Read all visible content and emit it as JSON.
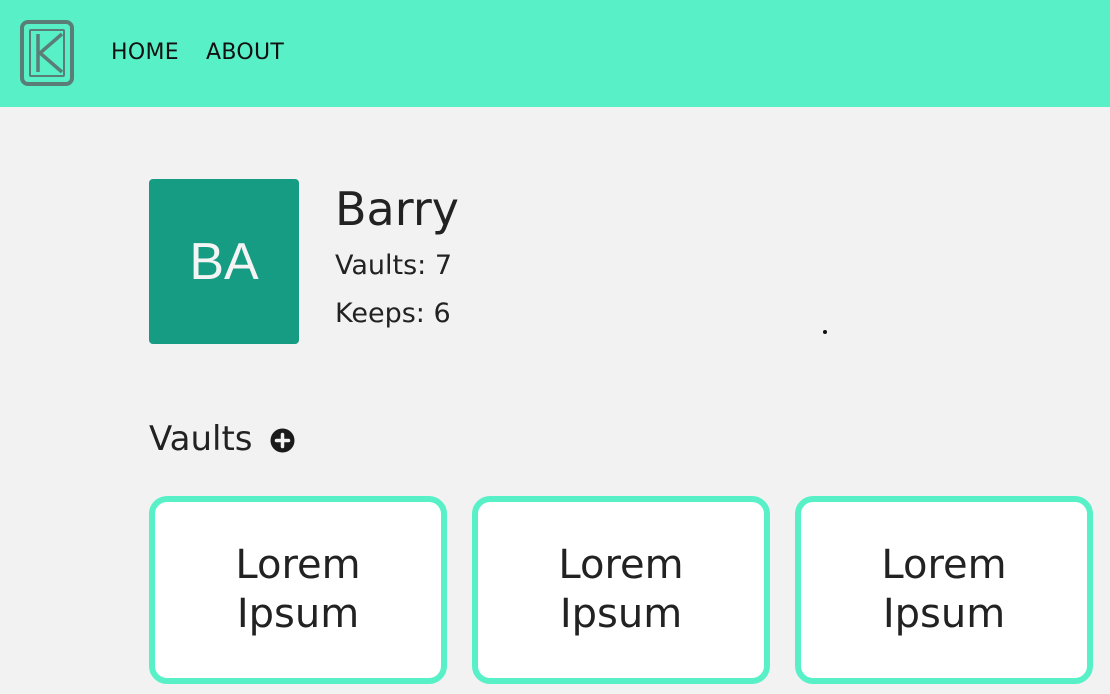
{
  "nav": {
    "home_label": "HOME",
    "about_label": "ABOUT",
    "logo_letter": "K",
    "colors": {
      "bar": "#58f0c6",
      "logo_stroke": "#5a7d78"
    }
  },
  "profile": {
    "initials": "BA",
    "name": "Barry",
    "vaults_label": "Vaults: 7",
    "keeps_label": "Keeps: 6",
    "avatar_color": "#169c82"
  },
  "vaults_section": {
    "title": "Vaults",
    "add_icon": "plus-circle-icon",
    "cards": [
      {
        "title": "Lorem Ipsum"
      },
      {
        "title": "Lorem Ipsum"
      },
      {
        "title": "Lorem Ipsum"
      }
    ],
    "card_border_color": "#58f0c6"
  }
}
